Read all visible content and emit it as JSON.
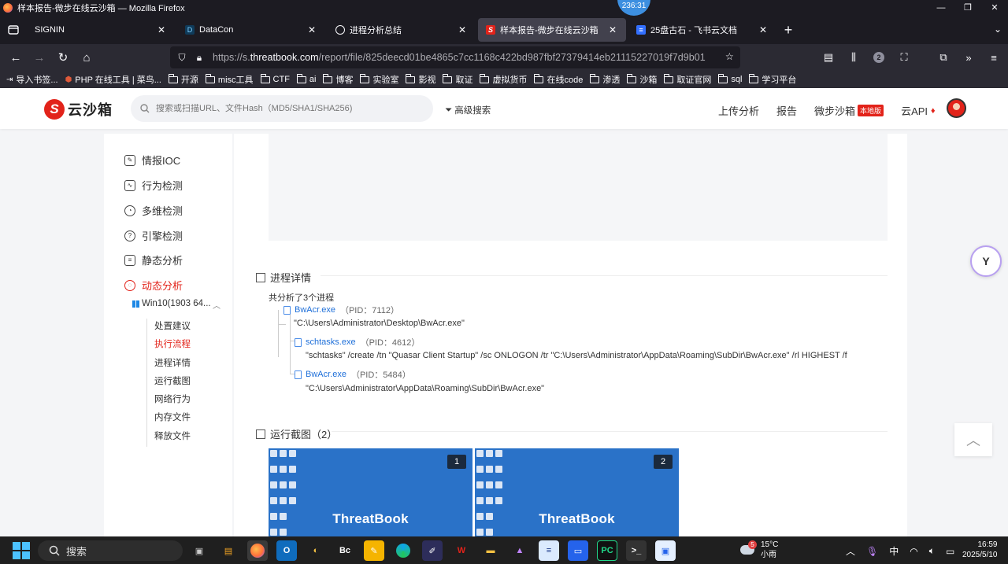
{
  "window": {
    "title": "样本报告-微步在线云沙箱 — Mozilla Firefox",
    "timer": "236:31"
  },
  "tabs": [
    {
      "label": "SIGNIN",
      "active": false
    },
    {
      "label": "DataCon",
      "active": false
    },
    {
      "label": "进程分析总结",
      "active": false
    },
    {
      "label": "样本报告-微步在线云沙箱",
      "active": true
    },
    {
      "label": "25盘古石 - 飞书云文档",
      "active": false
    }
  ],
  "navbar": {
    "url_prefix": "https://s.",
    "url_domain": "threatbook.com",
    "url_path": "/report/file/825deecd01be4865c7cc1168c422bd987fbf27379414eb21115227019f7d9b01",
    "extensions_badge": "2"
  },
  "bookmarks": [
    "导入书签...",
    "PHP 在线工具 | 菜鸟...",
    "开源",
    "misc工具",
    "CTF",
    "ai",
    "博客",
    "实验室",
    "影视",
    "取证",
    "虚拟货币",
    "在线code",
    "渗透",
    "沙箱",
    "取证官网",
    "sql",
    "学习平台"
  ],
  "site": {
    "logo_text": "云沙箱",
    "search_placeholder": "搜索或扫描URL、文件Hash（MD5/SHA1/SHA256)",
    "advanced_search": "高级搜索",
    "nav": {
      "upload": "上传分析",
      "report": "报告",
      "sandbox": "微步沙箱",
      "local_tag": "本地版",
      "api": "云API"
    }
  },
  "sidebar": {
    "items": [
      {
        "label": "情报IOC",
        "icon": "edit-icon"
      },
      {
        "label": "行为检测",
        "icon": "monitor-icon"
      },
      {
        "label": "多维检测",
        "icon": "radar-icon"
      },
      {
        "label": "引擎检测",
        "icon": "question-icon"
      },
      {
        "label": "静态分析",
        "icon": "list-icon"
      },
      {
        "label": "动态分析",
        "icon": "dynamic-icon",
        "active": true
      }
    ],
    "os_label": "Win10(1903 64...",
    "sub_items": [
      {
        "label": "处置建议"
      },
      {
        "label": "执行流程",
        "active": true
      },
      {
        "label": "进程详情"
      },
      {
        "label": "运行截图"
      },
      {
        "label": "网络行为"
      },
      {
        "label": "内存文件"
      },
      {
        "label": "释放文件"
      }
    ]
  },
  "main": {
    "process_section_title": "进程详情",
    "process_summary": "共分析了3个进程",
    "processes": [
      {
        "name": "BwAcr.exe",
        "pid": "（PID：7112）",
        "cmd": "\"C:\\Users\\Administrator\\Desktop\\BwAcr.exe\""
      },
      {
        "name": "schtasks.exe",
        "pid": "（PID：4612）",
        "cmd": "\"schtasks\" /create /tn \"Quasar Client Startup\" /sc ONLOGON /tr \"C:\\Users\\Administrator\\AppData\\Roaming\\SubDir\\BwAcr.exe\" /rl HIGHEST /f"
      },
      {
        "name": "BwAcr.exe",
        "pid": "（PID：5484）",
        "cmd": "\"C:\\Users\\Administrator\\AppData\\Roaming\\SubDir\\BwAcr.exe\""
      }
    ],
    "screenshot_section_title": "运行截图（2）",
    "screenshots": [
      {
        "brand": "ThreatBook",
        "num": "1"
      },
      {
        "brand": "ThreatBook",
        "num": "2"
      }
    ]
  },
  "taskbar": {
    "search": "搜索",
    "weather_temp": "15°C",
    "weather_desc": "小雨",
    "weather_badge": "5",
    "ime": "中",
    "time": "16:59",
    "date": "2025/5/10"
  }
}
